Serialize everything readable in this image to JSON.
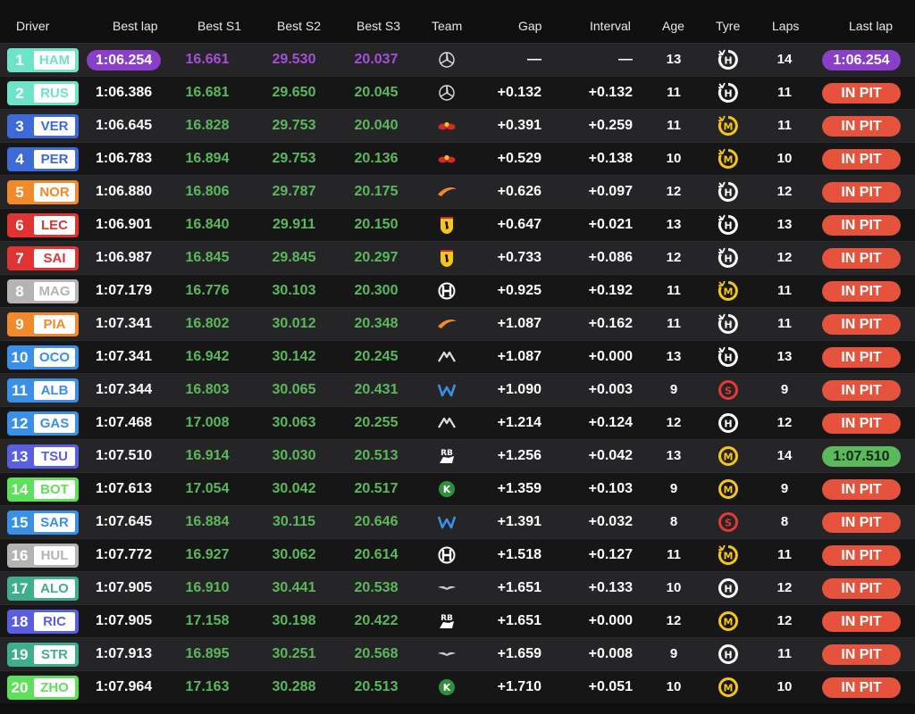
{
  "header": {
    "driver": "Driver",
    "best_lap": "Best lap",
    "best_s1": "Best S1",
    "best_s2": "Best S2",
    "best_s3": "Best S3",
    "team": "Team",
    "gap": "Gap",
    "interval": "Interval",
    "age": "Age",
    "tyre": "Tyre",
    "laps": "Laps",
    "last_lap": "Last lap"
  },
  "colors": {
    "purple": "#8a3fc8",
    "green": "#5cb85c",
    "pit": "#e5533c",
    "hard": "#ffffff",
    "medium": "#f5c518",
    "soft": "#e53935"
  },
  "rows": [
    {
      "pos": "1",
      "code": "HAM",
      "color": "#6ee3c8",
      "best": "1:06.254",
      "best_fastest": true,
      "s1": "16.661",
      "s2": "29.530",
      "s3": "20.037",
      "s1c": "purple",
      "s2c": "purple",
      "s3c": "purple",
      "team": "mercedes-logo-icon",
      "gap": "—",
      "interval": "—",
      "age": "13",
      "tyre": "H",
      "tyre_used": true,
      "laps": "14",
      "last": "1:06.254",
      "last_kind": "fast"
    },
    {
      "pos": "2",
      "code": "RUS",
      "color": "#6ee3c8",
      "best": "1:06.386",
      "s1": "16.681",
      "s2": "29.650",
      "s3": "20.045",
      "s1c": "green",
      "s2c": "green",
      "s3c": "green",
      "team": "mercedes-logo-icon",
      "gap": "+0.132",
      "interval": "+0.132",
      "age": "11",
      "tyre": "H",
      "tyre_used": true,
      "laps": "11",
      "last": "IN PIT",
      "last_kind": "pit"
    },
    {
      "pos": "3",
      "code": "VER",
      "color": "#3e6ad8",
      "best": "1:06.645",
      "s1": "16.828",
      "s2": "29.753",
      "s3": "20.040",
      "s1c": "green",
      "s2c": "green",
      "s3c": "green",
      "team": "red-bull-logo-icon",
      "gap": "+0.391",
      "interval": "+0.259",
      "age": "11",
      "tyre": "M",
      "tyre_used": true,
      "laps": "11",
      "last": "IN PIT",
      "last_kind": "pit"
    },
    {
      "pos": "4",
      "code": "PER",
      "color": "#3e6ad8",
      "best": "1:06.783",
      "s1": "16.894",
      "s2": "29.753",
      "s3": "20.136",
      "s1c": "green",
      "s2c": "green",
      "s3c": "green",
      "team": "red-bull-logo-icon",
      "gap": "+0.529",
      "interval": "+0.138",
      "age": "10",
      "tyre": "M",
      "tyre_used": true,
      "laps": "10",
      "last": "IN PIT",
      "last_kind": "pit"
    },
    {
      "pos": "5",
      "code": "NOR",
      "color": "#f08a2a",
      "best": "1:06.880",
      "s1": "16.806",
      "s2": "29.787",
      "s3": "20.175",
      "s1c": "green",
      "s2c": "green",
      "s3c": "green",
      "team": "mclaren-logo-icon",
      "gap": "+0.626",
      "interval": "+0.097",
      "age": "12",
      "tyre": "H",
      "tyre_used": true,
      "laps": "12",
      "last": "IN PIT",
      "last_kind": "pit"
    },
    {
      "pos": "6",
      "code": "LEC",
      "color": "#e03434",
      "best": "1:06.901",
      "s1": "16.840",
      "s2": "29.911",
      "s3": "20.150",
      "s1c": "green",
      "s2c": "green",
      "s3c": "green",
      "team": "ferrari-logo-icon",
      "gap": "+0.647",
      "interval": "+0.021",
      "age": "13",
      "tyre": "H",
      "tyre_used": true,
      "laps": "13",
      "last": "IN PIT",
      "last_kind": "pit"
    },
    {
      "pos": "7",
      "code": "SAI",
      "color": "#e03434",
      "best": "1:06.987",
      "s1": "16.845",
      "s2": "29.845",
      "s3": "20.297",
      "s1c": "green",
      "s2c": "green",
      "s3c": "green",
      "team": "ferrari-logo-icon",
      "gap": "+0.733",
      "interval": "+0.086",
      "age": "12",
      "tyre": "H",
      "tyre_used": true,
      "laps": "12",
      "last": "IN PIT",
      "last_kind": "pit"
    },
    {
      "pos": "8",
      "code": "MAG",
      "color": "#b4b4b4",
      "best": "1:07.179",
      "s1": "16.776",
      "s2": "30.103",
      "s3": "20.300",
      "s1c": "green",
      "s2c": "green",
      "s3c": "green",
      "team": "haas-logo-icon",
      "gap": "+0.925",
      "interval": "+0.192",
      "age": "11",
      "tyre": "M",
      "tyre_used": true,
      "laps": "11",
      "last": "IN PIT",
      "last_kind": "pit"
    },
    {
      "pos": "9",
      "code": "PIA",
      "color": "#f08a2a",
      "best": "1:07.341",
      "s1": "16.802",
      "s2": "30.012",
      "s3": "20.348",
      "s1c": "green",
      "s2c": "green",
      "s3c": "green",
      "team": "mclaren-logo-icon",
      "gap": "+1.087",
      "interval": "+0.162",
      "age": "11",
      "tyre": "H",
      "tyre_used": true,
      "laps": "11",
      "last": "IN PIT",
      "last_kind": "pit"
    },
    {
      "pos": "10",
      "code": "OCO",
      "color": "#3a8fe6",
      "best": "1:07.341",
      "s1": "16.942",
      "s2": "30.142",
      "s3": "20.245",
      "s1c": "green",
      "s2c": "green",
      "s3c": "green",
      "team": "alpine-logo-icon",
      "gap": "+1.087",
      "interval": "+0.000",
      "age": "13",
      "tyre": "H",
      "tyre_used": true,
      "laps": "13",
      "last": "IN PIT",
      "last_kind": "pit"
    },
    {
      "pos": "11",
      "code": "ALB",
      "color": "#3a8fe6",
      "best": "1:07.344",
      "s1": "16.803",
      "s2": "30.065",
      "s3": "20.431",
      "s1c": "green",
      "s2c": "green",
      "s3c": "green",
      "team": "williams-logo-icon",
      "gap": "+1.090",
      "interval": "+0.003",
      "age": "9",
      "tyre": "S",
      "tyre_used": false,
      "laps": "9",
      "last": "IN PIT",
      "last_kind": "pit"
    },
    {
      "pos": "12",
      "code": "GAS",
      "color": "#3a8fe6",
      "best": "1:07.468",
      "s1": "17.008",
      "s2": "30.063",
      "s3": "20.255",
      "s1c": "green",
      "s2c": "green",
      "s3c": "green",
      "team": "alpine-logo-icon",
      "gap": "+1.214",
      "interval": "+0.124",
      "age": "12",
      "tyre": "H",
      "tyre_used": false,
      "laps": "12",
      "last": "IN PIT",
      "last_kind": "pit"
    },
    {
      "pos": "13",
      "code": "TSU",
      "color": "#5a5ee0",
      "best": "1:07.510",
      "s1": "16.914",
      "s2": "30.030",
      "s3": "20.513",
      "s1c": "green",
      "s2c": "green",
      "s3c": "green",
      "team": "racing-bulls-logo-icon",
      "gap": "+1.256",
      "interval": "+0.042",
      "age": "13",
      "tyre": "M",
      "tyre_used": false,
      "laps": "14",
      "last": "1:07.510",
      "last_kind": "pb"
    },
    {
      "pos": "14",
      "code": "BOT",
      "color": "#5fe05a",
      "best": "1:07.613",
      "s1": "17.054",
      "s2": "30.042",
      "s3": "20.517",
      "s1c": "green",
      "s2c": "green",
      "s3c": "green",
      "team": "kick-sauber-logo-icon",
      "gap": "+1.359",
      "interval": "+0.103",
      "age": "9",
      "tyre": "M",
      "tyre_used": false,
      "laps": "9",
      "last": "IN PIT",
      "last_kind": "pit"
    },
    {
      "pos": "15",
      "code": "SAR",
      "color": "#3a8fe6",
      "best": "1:07.645",
      "s1": "16.884",
      "s2": "30.115",
      "s3": "20.646",
      "s1c": "green",
      "s2c": "green",
      "s3c": "green",
      "team": "williams-logo-icon",
      "gap": "+1.391",
      "interval": "+0.032",
      "age": "8",
      "tyre": "S",
      "tyre_used": false,
      "laps": "8",
      "last": "IN PIT",
      "last_kind": "pit"
    },
    {
      "pos": "16",
      "code": "HUL",
      "color": "#b4b4b4",
      "best": "1:07.772",
      "s1": "16.927",
      "s2": "30.062",
      "s3": "20.614",
      "s1c": "green",
      "s2c": "green",
      "s3c": "green",
      "team": "haas-logo-icon",
      "gap": "+1.518",
      "interval": "+0.127",
      "age": "11",
      "tyre": "M",
      "tyre_used": true,
      "laps": "11",
      "last": "IN PIT",
      "last_kind": "pit"
    },
    {
      "pos": "17",
      "code": "ALO",
      "color": "#3fae8a",
      "best": "1:07.905",
      "s1": "16.910",
      "s2": "30.441",
      "s3": "20.538",
      "s1c": "green",
      "s2c": "green",
      "s3c": "green",
      "team": "aston-martin-logo-icon",
      "gap": "+1.651",
      "interval": "+0.133",
      "age": "10",
      "tyre": "H",
      "tyre_used": false,
      "laps": "12",
      "last": "IN PIT",
      "last_kind": "pit"
    },
    {
      "pos": "18",
      "code": "RIC",
      "color": "#5a5ee0",
      "best": "1:07.905",
      "s1": "17.158",
      "s2": "30.198",
      "s3": "20.422",
      "s1c": "green",
      "s2c": "green",
      "s3c": "green",
      "team": "racing-bulls-logo-icon",
      "gap": "+1.651",
      "interval": "+0.000",
      "age": "12",
      "tyre": "M",
      "tyre_used": false,
      "laps": "12",
      "last": "IN PIT",
      "last_kind": "pit"
    },
    {
      "pos": "19",
      "code": "STR",
      "color": "#3fae8a",
      "best": "1:07.913",
      "s1": "16.895",
      "s2": "30.251",
      "s3": "20.568",
      "s1c": "green",
      "s2c": "green",
      "s3c": "green",
      "team": "aston-martin-logo-icon",
      "gap": "+1.659",
      "interval": "+0.008",
      "age": "9",
      "tyre": "H",
      "tyre_used": false,
      "laps": "11",
      "last": "IN PIT",
      "last_kind": "pit"
    },
    {
      "pos": "20",
      "code": "ZHO",
      "color": "#5fe05a",
      "best": "1:07.964",
      "s1": "17.163",
      "s2": "30.288",
      "s3": "20.513",
      "s1c": "green",
      "s2c": "green",
      "s3c": "green",
      "team": "kick-sauber-logo-icon",
      "gap": "+1.710",
      "interval": "+0.051",
      "age": "10",
      "tyre": "M",
      "tyre_used": false,
      "laps": "10",
      "last": "IN PIT",
      "last_kind": "pit"
    }
  ]
}
